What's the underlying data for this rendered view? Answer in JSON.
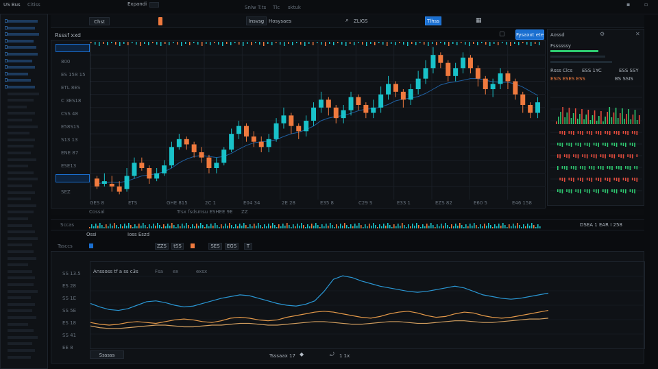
{
  "titlebar": {
    "app_name": "US Bus",
    "app_sub": "Citiss",
    "menu": "Expandi",
    "btn1": "",
    "btn2": "",
    "center_labels": [
      "Snlw",
      "T:ts",
      "Tlc",
      "sktuk"
    ]
  },
  "toolbar": {
    "symbol": "Chst",
    "search_label": "Insvsg",
    "view_label": "Hosysaes",
    "zoom_label": "ZLIGS",
    "blue_label": "Tlhss"
  },
  "chart_header": {
    "title": "Rsssf xxd",
    "trade_button": "Fysaxxt ete"
  },
  "left_axis": {
    "labels": [
      "E53 SES",
      "800",
      "ES 158 15",
      "ETL 8ES",
      "C 3ES18",
      "CSS 48",
      "E58S1S",
      "S13 13",
      "ENE 87",
      "ESE13",
      "Fass Ed",
      "SEZ"
    ]
  },
  "x_axis_labels": [
    "GES 8",
    "ETS",
    "GHE 815",
    "2C 1",
    "E04 34",
    "2E 28",
    "E35 8",
    "C29 S",
    "E33 1",
    "EZS 82",
    "E60 5",
    "E46 158"
  ],
  "info_bar": {
    "left": "Cossal",
    "mid": "Trsx fsdsmsu ESHEE 9E",
    "right": "ZZ"
  },
  "volume_bar": {
    "label": "Sccas",
    "right": "DSEA 1 EAR I 258"
  },
  "indicator_toolbar": {
    "title": "Ossi",
    "tag": "Ioss Eszd",
    "buttons": [
      "ZZS",
      "tSS",
      "SES",
      "EGS",
      "T"
    ],
    "left_label": "Tssccs"
  },
  "lower_chart": {
    "header": "Anssoss tf  a ss c3s",
    "legend": [
      "Fsa",
      "ex",
      "exsx"
    ],
    "footer_left": "Ssssss",
    "footer_mid": "Tsssaax  17",
    "footer_right": "1 1x"
  },
  "right_panel": {
    "header": "Aossd",
    "section1": "Fssssssy",
    "book_title": "Rsss Clcs",
    "book_title2": "ESS 1YC",
    "book_title3": "ESS SSY",
    "price": "ESIS ESES ESS",
    "price2": "BS SSIS"
  },
  "colors": {
    "up": "#19c2c9",
    "down": "#f07a3e",
    "accent": "#1a6fd0",
    "green": "#2ecc71",
    "red": "#e74c3c"
  },
  "chart_data": [
    {
      "type": "candlestick",
      "title": "Rsssf xxd",
      "candles": [
        [
          31,
          32,
          29,
          33,
          28
        ],
        [
          32,
          30,
          31,
          34,
          29
        ],
        [
          33,
          30,
          29,
          33,
          27
        ],
        [
          30,
          29,
          27,
          31,
          26
        ],
        [
          34,
          28,
          33,
          36,
          27
        ],
        [
          35,
          33,
          38,
          40,
          32
        ],
        [
          36,
          38,
          36,
          40,
          35
        ],
        [
          37,
          36,
          32,
          37,
          30
        ],
        [
          38,
          32,
          34,
          36,
          31
        ],
        [
          39,
          34,
          37,
          39,
          33
        ],
        [
          40,
          37,
          44,
          46,
          36
        ],
        [
          41,
          44,
          47,
          49,
          43
        ],
        [
          42,
          47,
          45,
          48,
          43
        ],
        [
          43,
          45,
          42,
          46,
          40
        ],
        [
          44,
          42,
          40,
          44,
          38
        ],
        [
          45,
          40,
          36,
          41,
          34
        ],
        [
          46,
          36,
          38,
          40,
          34
        ],
        [
          47,
          38,
          43,
          44,
          37
        ],
        [
          48,
          43,
          49,
          51,
          42
        ],
        [
          49,
          49,
          52,
          54,
          47
        ],
        [
          50,
          52,
          48,
          53,
          46
        ],
        [
          51,
          48,
          46,
          50,
          44
        ],
        [
          52,
          46,
          44,
          48,
          42
        ],
        [
          53,
          44,
          47,
          49,
          42
        ],
        [
          54,
          47,
          53,
          55,
          46
        ],
        [
          55,
          53,
          56,
          59,
          51
        ],
        [
          56,
          56,
          52,
          57,
          49
        ],
        [
          57,
          52,
          50,
          53,
          47
        ],
        [
          58,
          50,
          54,
          56,
          48
        ],
        [
          59,
          54,
          59,
          61,
          52
        ],
        [
          60,
          59,
          62,
          65,
          57
        ],
        [
          61,
          62,
          59,
          63,
          56
        ],
        [
          62,
          59,
          55,
          60,
          53
        ],
        [
          63,
          55,
          58,
          60,
          53
        ],
        [
          64,
          58,
          63,
          65,
          56
        ],
        [
          65,
          63,
          60,
          64,
          58
        ],
        [
          66,
          60,
          57,
          61,
          55
        ],
        [
          67,
          57,
          59,
          62,
          55
        ],
        [
          68,
          59,
          64,
          67,
          57
        ],
        [
          69,
          64,
          68,
          71,
          62
        ],
        [
          70,
          68,
          65,
          69,
          63
        ],
        [
          71,
          65,
          62,
          66,
          59
        ],
        [
          72,
          62,
          66,
          68,
          60
        ],
        [
          73,
          66,
          70,
          73,
          64
        ],
        [
          74,
          70,
          74,
          77,
          68
        ],
        [
          75,
          74,
          79,
          82,
          72
        ],
        [
          76,
          79,
          76,
          80,
          74
        ],
        [
          77,
          76,
          71,
          77,
          69
        ],
        [
          78,
          71,
          74,
          76,
          69
        ],
        [
          79,
          74,
          78,
          80,
          72
        ],
        [
          80,
          78,
          74,
          79,
          72
        ],
        [
          81,
          74,
          70,
          75,
          67
        ],
        [
          82,
          70,
          66,
          71,
          64
        ],
        [
          83,
          66,
          68,
          70,
          63
        ],
        [
          84,
          68,
          72,
          74,
          66
        ],
        [
          85,
          72,
          69,
          73,
          66
        ],
        [
          86,
          69,
          64,
          70,
          62
        ],
        [
          87,
          64,
          60,
          65,
          57
        ],
        [
          88,
          60,
          57,
          61,
          55
        ],
        [
          89,
          57,
          61,
          63,
          55
        ]
      ],
      "ma": [
        30,
        30.5,
        30.7,
        30.5,
        31,
        32,
        33,
        33.4,
        33.8,
        34.6,
        36,
        38,
        39.4,
        40.4,
        40.8,
        40.4,
        40,
        40.4,
        41.6,
        43.2,
        44.6,
        45.6,
        46,
        46.2,
        46.8,
        48,
        49,
        49.6,
        50.6,
        52,
        54,
        55,
        55.6,
        56,
        56.8,
        57.8,
        58.4,
        58.6,
        59.2,
        60.2,
        61.6,
        62.2,
        62.6,
        63.2,
        64.4,
        66,
        67.6,
        68.4,
        68.8,
        69.4,
        70,
        70,
        69.4,
        68.8,
        68.6,
        68.6,
        68,
        66.8,
        65.2,
        63.6
      ],
      "ylim": [
        24,
        84
      ]
    },
    {
      "type": "line",
      "title": "Anssoss tf  a ss c3s",
      "series": [
        {
          "values": [
            52,
            48,
            45,
            44,
            46,
            50,
            54,
            55,
            53,
            50,
            48,
            49,
            52,
            55,
            58,
            60,
            62,
            61,
            58,
            55,
            52,
            50,
            49,
            51,
            55,
            66,
            80,
            84,
            82,
            78,
            75,
            72,
            70,
            68,
            66,
            65,
            66,
            68,
            70,
            72,
            70,
            66,
            62,
            60,
            58,
            57,
            58,
            60,
            62,
            64
          ]
        },
        {
          "values": [
            30,
            28,
            27,
            28,
            30,
            31,
            30,
            29,
            31,
            33,
            34,
            33,
            31,
            30,
            32,
            35,
            36,
            35,
            33,
            32,
            33,
            36,
            38,
            40,
            42,
            43,
            42,
            40,
            38,
            36,
            35,
            37,
            40,
            42,
            43,
            41,
            38,
            36,
            37,
            40,
            42,
            41,
            38,
            36,
            35,
            36,
            38,
            40,
            42,
            44
          ]
        },
        {
          "values": [
            26,
            24,
            23,
            23,
            24,
            25,
            26,
            27,
            27,
            26,
            25,
            25,
            26,
            27,
            27,
            28,
            29,
            29,
            28,
            27,
            27,
            28,
            29,
            30,
            31,
            31,
            30,
            29,
            28,
            28,
            29,
            30,
            31,
            31,
            30,
            29,
            29,
            30,
            31,
            32,
            32,
            31,
            30,
            30,
            31,
            32,
            33,
            34,
            34,
            35
          ]
        }
      ],
      "ylim": [
        0,
        100
      ]
    }
  ]
}
